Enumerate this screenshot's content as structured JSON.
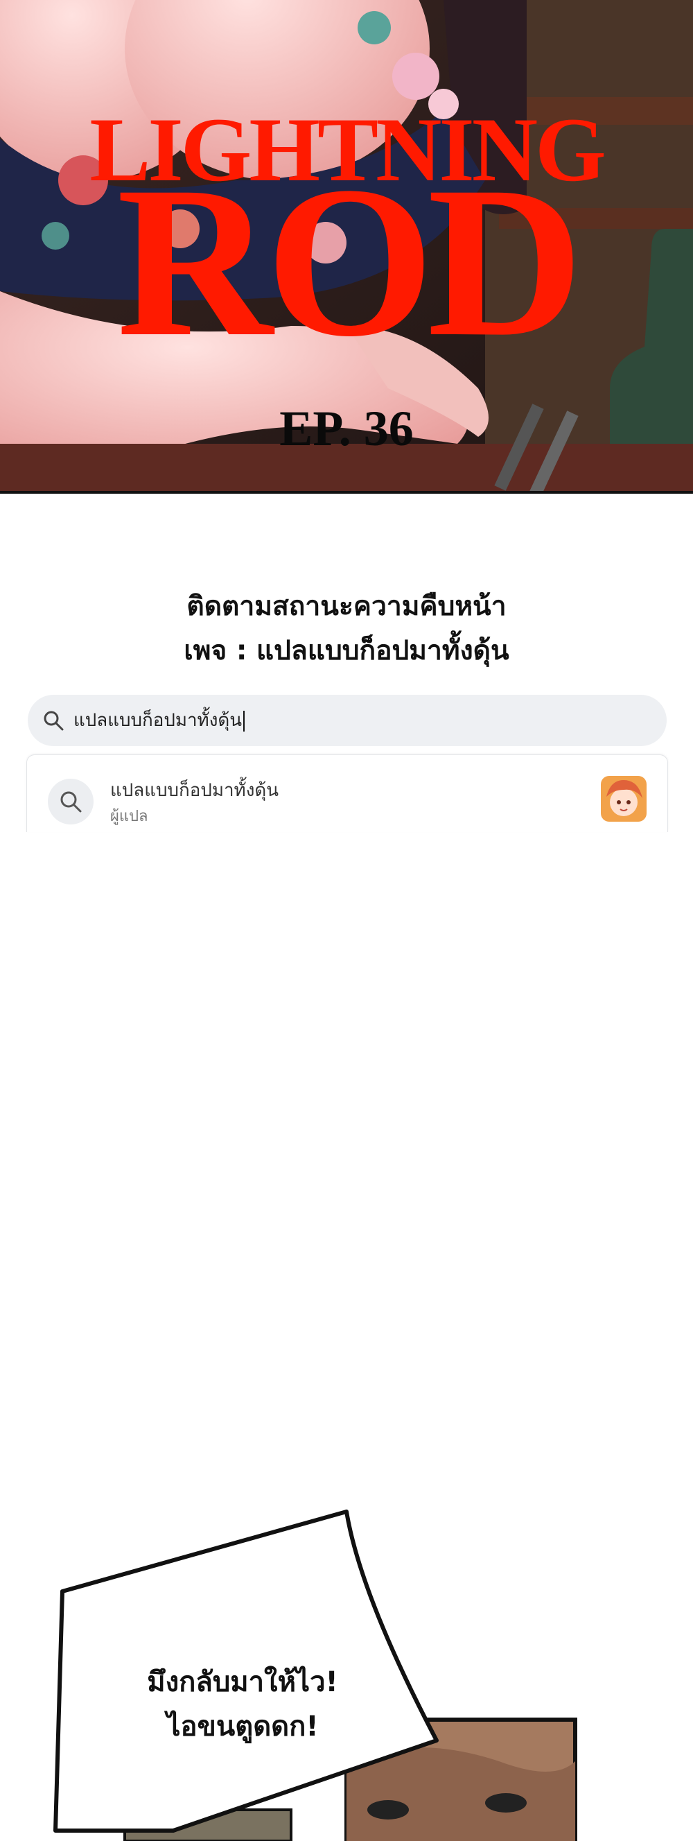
{
  "cover": {
    "title_line1": "LIGHTNING",
    "title_line2": "ROD",
    "episode": "EP. 36",
    "colors": {
      "title": "#ff1a00",
      "episode": "#0a0a0a"
    }
  },
  "promo": {
    "line1": "ติดตามสถานะความคืบหน้า",
    "line2": "เพจ : แปลแบบก็อปมาทั้งดุ้น"
  },
  "search": {
    "icon": "search-icon",
    "value": "แปลแบบก็อปมาทั้งดุ้น"
  },
  "suggestion": {
    "icon": "search-icon",
    "name": "แปลแบบก็อปมาทั้งดุ้น",
    "role": "ผู้แปล",
    "avatar": "page-avatar"
  },
  "speech_bubble": {
    "line1": "มึงกลับมาให้ไว!",
    "line2": "ไอขนตูดดก!"
  }
}
